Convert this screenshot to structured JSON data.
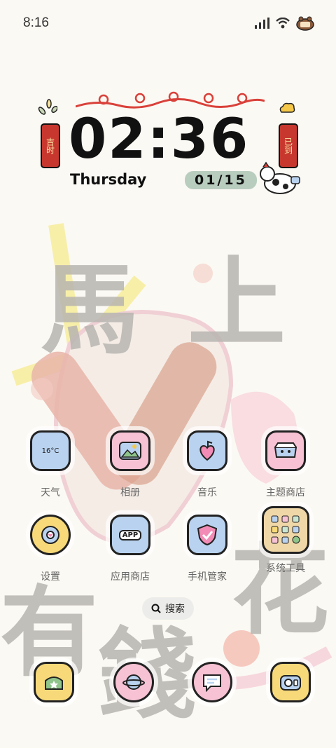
{
  "status_bar": {
    "time": "8:16"
  },
  "clock": {
    "time": "02:36",
    "weekday": "Thursday",
    "date": "01/15",
    "tag_left": "吉时",
    "tag_right": "已到"
  },
  "wallpaper": {
    "chars": [
      "馬",
      "上",
      "有",
      "錢",
      "花"
    ]
  },
  "apps": [
    {
      "label": "天气",
      "badge": "16°C"
    },
    {
      "label": "相册"
    },
    {
      "label": "音乐"
    },
    {
      "label": "主题商店"
    },
    {
      "label": "设置"
    },
    {
      "label": "应用商店",
      "badge": "APP"
    },
    {
      "label": "手机管家"
    },
    {
      "label": "系统工具"
    }
  ],
  "search": {
    "label": "搜索"
  },
  "colors": {
    "blue": "#b9d2ef",
    "pink": "#f7c2d4",
    "yellow": "#f7d97a",
    "tan": "#f0d7a8",
    "mint": "#c9e6d2",
    "red": "#d9413a"
  }
}
